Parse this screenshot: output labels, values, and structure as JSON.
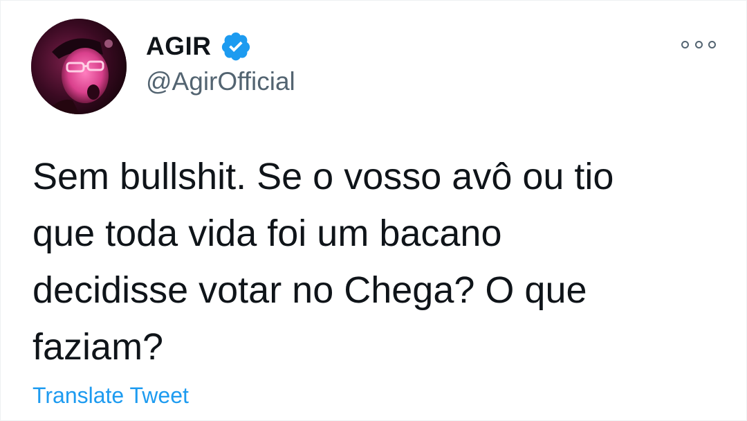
{
  "tweet": {
    "author": {
      "display_name": "AGIR",
      "handle": "@AgirOfficial",
      "verified": true,
      "avatar_icon": "profile-photo"
    },
    "text_lines": [
      "Sem bullshit. Se o vosso avô ou tio",
      "que toda vida foi um bacano",
      "decidisse votar no Chega? O que",
      "faziam?"
    ],
    "translate_label": "Translate Tweet",
    "more_icon": "more-options-icon"
  },
  "colors": {
    "text": "#0f1419",
    "secondary": "#536471",
    "link": "#1d9bf0",
    "verified_badge": "#1d9bf0",
    "background": "#ffffff"
  }
}
